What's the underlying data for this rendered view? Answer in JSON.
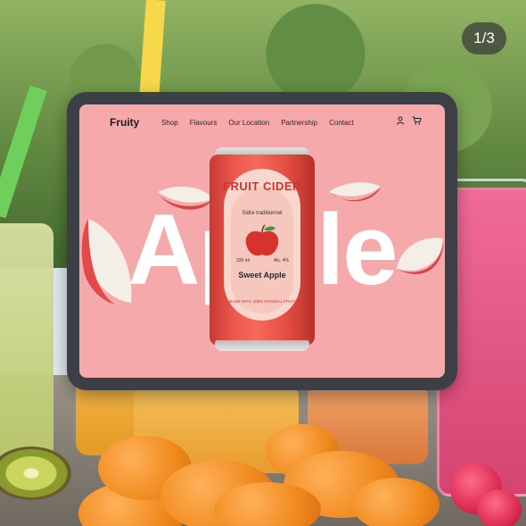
{
  "counter": "1/3",
  "site": {
    "brand": "Fruity",
    "nav": [
      "Shop",
      "Flavours",
      "Our Location",
      "Partnership",
      "Contact"
    ],
    "icons": [
      "user-icon",
      "cart-icon"
    ]
  },
  "hero": {
    "word": "Apple"
  },
  "can": {
    "title": "FRUIT CIDER",
    "subtitle": "Sidre traditionnel",
    "volume_left": "330 ml",
    "volume_right": "Alc. 4%",
    "flavour": "Sweet Apple",
    "made": "MADE WITH 100% NATURAL FRUIT"
  },
  "colors": {
    "screen_bg": "#f6a9aa",
    "can_red": "#e24c40"
  }
}
